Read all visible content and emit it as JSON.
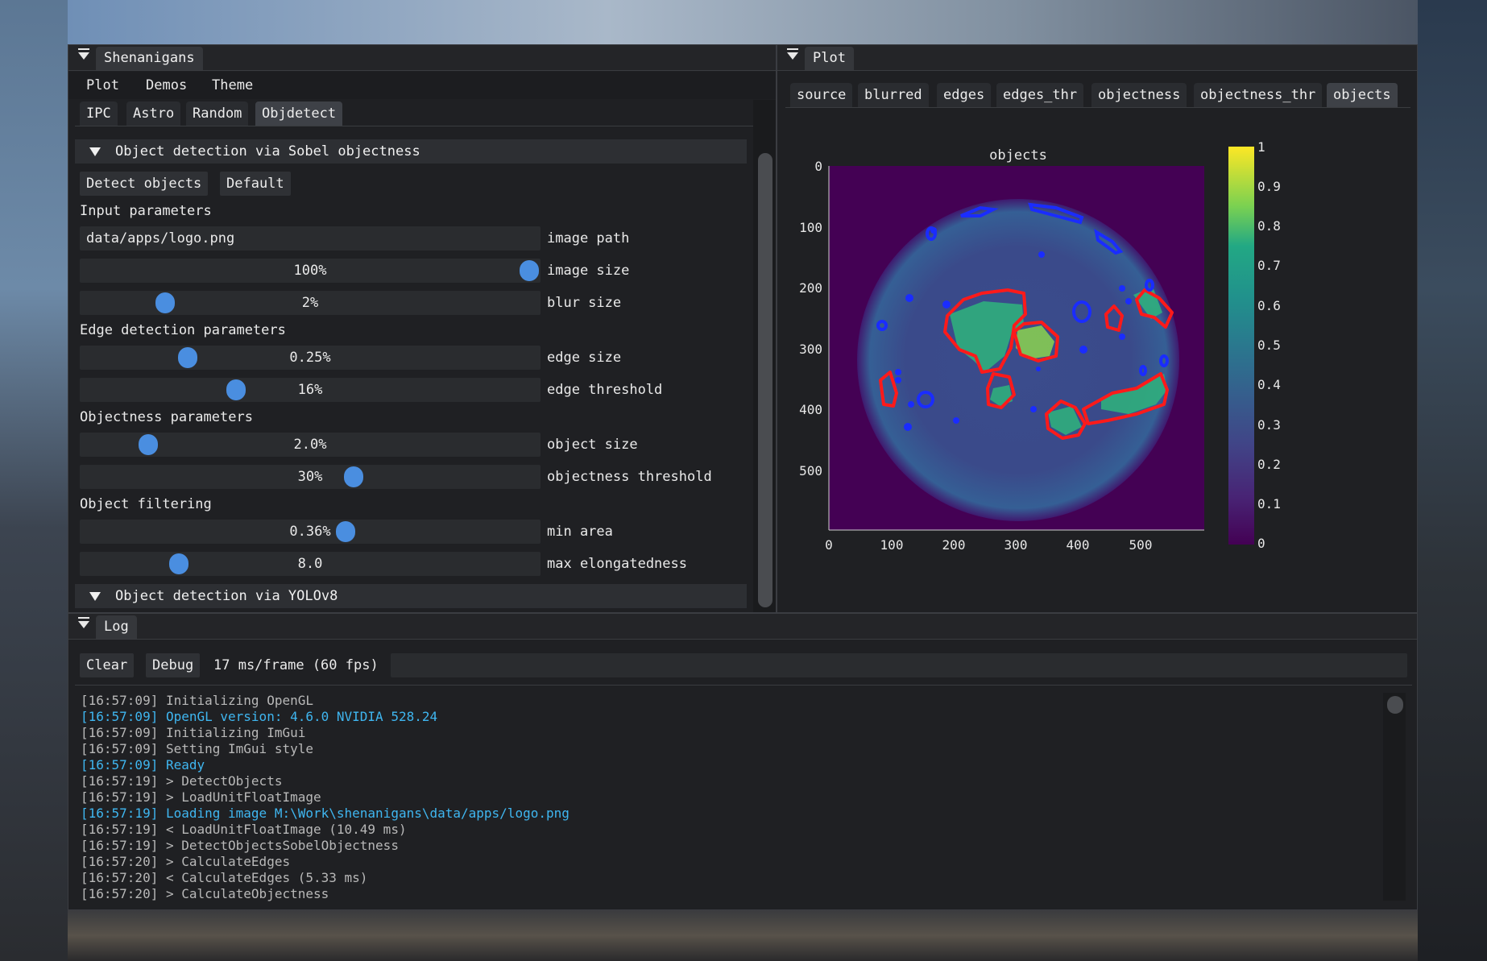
{
  "shenanigans": {
    "title": "Shenanigans",
    "menu": [
      "Plot",
      "Demos",
      "Theme"
    ],
    "tabs": [
      "IPC",
      "Astro",
      "Random",
      "Objdetect"
    ],
    "active_tab": "Objdetect",
    "section1": "Object detection via Sobel objectness",
    "buttons": {
      "detect": "Detect objects",
      "default": "Default"
    },
    "groups": {
      "input": "Input parameters",
      "edge": "Edge detection parameters",
      "objectness": "Objectness parameters",
      "filtering": "Object filtering"
    },
    "params": {
      "image_path": {
        "value": "data/apps/logo.png",
        "label": "image path"
      },
      "image_size": {
        "value": "100%",
        "label": "image size",
        "level": 1.0
      },
      "blur_size": {
        "value": "2%",
        "label": "blur size",
        "level": 0.17
      },
      "edge_size": {
        "value": "0.25%",
        "label": "edge size",
        "level": 0.22
      },
      "edge_threshold": {
        "value": "16%",
        "label": "edge threshold",
        "level": 0.33
      },
      "object_size": {
        "value": "2.0%",
        "label": "object size",
        "level": 0.13
      },
      "objectness_threshold": {
        "value": "30%",
        "label": "objectness threshold",
        "level": 0.6
      },
      "min_area": {
        "value": "0.36%",
        "label": "min area",
        "level": 0.58
      },
      "max_elongatedness": {
        "value": "8.0",
        "label": "max elongatedness",
        "level": 0.2
      }
    },
    "section2": "Object detection via YOLOv8"
  },
  "plot_window": {
    "title": "Plot",
    "tabs": [
      "source",
      "blurred",
      "edges",
      "edges_thr",
      "objectness",
      "objectness_thr",
      "objects"
    ],
    "active_tab": "objects"
  },
  "chart_data": {
    "type": "heatmap",
    "title": "objects",
    "xlabel": "",
    "ylabel": "",
    "x_ticks": [
      "0",
      "100",
      "200",
      "300",
      "400",
      "500"
    ],
    "y_ticks": [
      "0",
      "100",
      "200",
      "300",
      "400",
      "500"
    ],
    "xlim": [
      0,
      600
    ],
    "ylim": [
      600,
      0
    ],
    "colormap": "viridis",
    "colorbar_ticks": [
      "1",
      "0.9",
      "0.8",
      "0.7",
      "0.6",
      "0.5",
      "0.4",
      "0.3",
      "0.2",
      "0.1",
      "0"
    ],
    "colorbar_range": [
      0,
      1
    ],
    "overlay_colors": {
      "large_objects": "#ff1a1a",
      "small_objects": "#1030ff"
    }
  },
  "log": {
    "title": "Log",
    "buttons": {
      "clear": "Clear",
      "debug": "Debug"
    },
    "fps": "17 ms/frame (60 fps)",
    "lines": [
      {
        "text": "[16:57:09] Initializing OpenGL",
        "level": "debug"
      },
      {
        "text": "[16:57:09] OpenGL version: 4.6.0 NVIDIA 528.24",
        "level": "info"
      },
      {
        "text": "[16:57:09] Initializing ImGui",
        "level": "debug"
      },
      {
        "text": "[16:57:09] Setting ImGui style",
        "level": "debug"
      },
      {
        "text": "[16:57:09] Ready",
        "level": "info"
      },
      {
        "text": "[16:57:19] > DetectObjects",
        "level": "debug"
      },
      {
        "text": "[16:57:19] > LoadUnitFloatImage",
        "level": "debug"
      },
      {
        "text": "[16:57:19] Loading image M:\\Work\\shenanigans\\data/apps/logo.png",
        "level": "info"
      },
      {
        "text": "[16:57:19] < LoadUnitFloatImage (10.49 ms)",
        "level": "debug"
      },
      {
        "text": "[16:57:19] > DetectObjectsSobelObjectness",
        "level": "debug"
      },
      {
        "text": "[16:57:20] > CalculateEdges",
        "level": "debug"
      },
      {
        "text": "[16:57:20] < CalculateEdges (5.33 ms)",
        "level": "debug"
      },
      {
        "text": "[16:57:20] > CalculateObjectness",
        "level": "debug"
      }
    ]
  }
}
